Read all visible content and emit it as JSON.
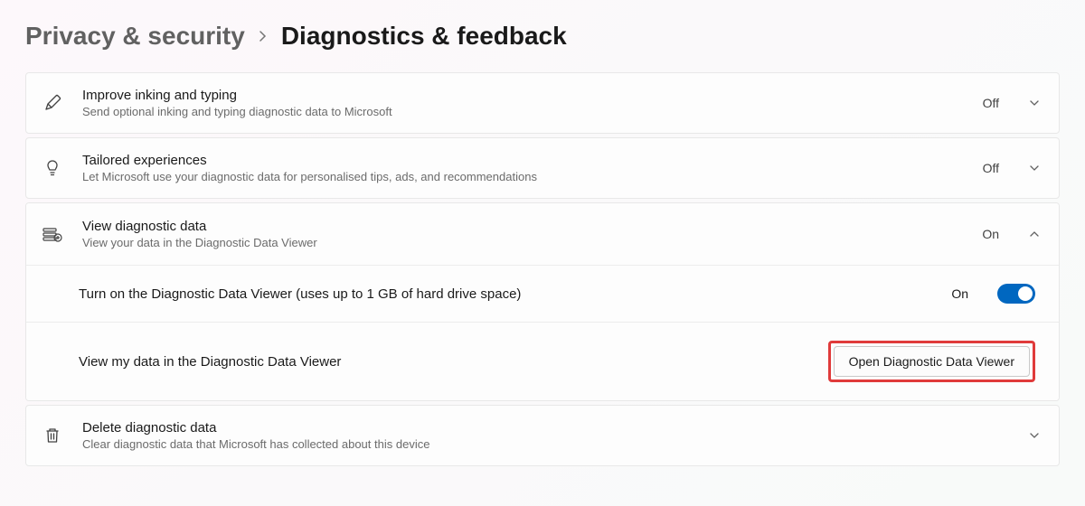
{
  "breadcrumb": {
    "parent": "Privacy & security",
    "current": "Diagnostics & feedback"
  },
  "items": {
    "inking": {
      "title": "Improve inking and typing",
      "desc": "Send optional inking and typing diagnostic data to Microsoft",
      "state": "Off"
    },
    "tailored": {
      "title": "Tailored experiences",
      "desc": "Let Microsoft use your diagnostic data for personalised tips, ads, and recommendations",
      "state": "Off"
    },
    "viewdata": {
      "title": "View diagnostic data",
      "desc": "View your data in the Diagnostic Data Viewer",
      "state": "On",
      "sub_toggle": {
        "label": "Turn on the Diagnostic Data Viewer (uses up to 1 GB of hard drive space)",
        "state": "On"
      },
      "sub_action": {
        "label": "View my data in the Diagnostic Data Viewer",
        "button": "Open Diagnostic Data Viewer"
      }
    },
    "delete": {
      "title": "Delete diagnostic data",
      "desc": "Clear diagnostic data that Microsoft has collected about this device"
    }
  }
}
